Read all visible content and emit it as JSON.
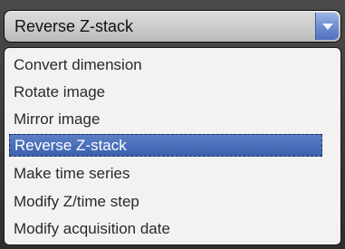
{
  "combo": {
    "value": "Reverse Z-stack",
    "button_icon": "chevron-down-icon"
  },
  "dropdown": {
    "items": [
      {
        "label": "Convert dimension"
      },
      {
        "label": "Rotate image"
      },
      {
        "label": "Mirror image"
      },
      {
        "label": "Reverse Z-stack",
        "selected": true
      },
      {
        "label": "Make time series"
      },
      {
        "label": "Modify Z/time step"
      },
      {
        "label": "Modify acquisition date"
      }
    ]
  },
  "colors": {
    "selection": "#3b61b0",
    "list_background": "#f2f2f2",
    "combo_button": "#6f8fd3"
  }
}
